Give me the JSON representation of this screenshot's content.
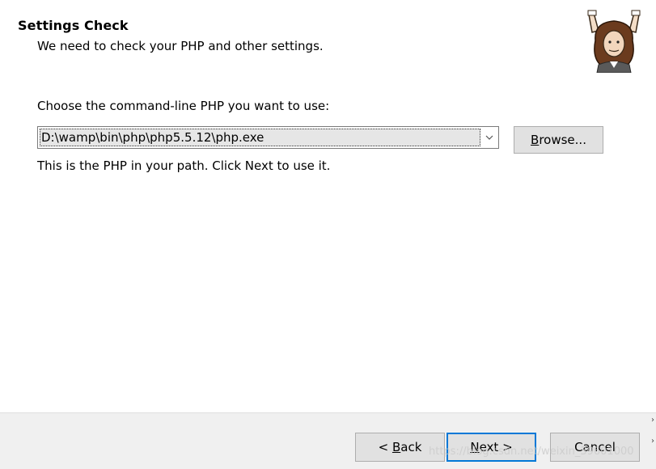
{
  "header": {
    "title": "Settings Check",
    "subtitle": "We need to check your PHP and other settings.",
    "logo_icon": "composer-conductor-logo"
  },
  "main": {
    "prompt_label": "Choose the command-line PHP you want to use:",
    "php_path": {
      "value": "D:\\wamp\\bin\\php\\php5.5.12\\php.exe",
      "dropdown_icon": "chevron-down-icon"
    },
    "browse_button": {
      "label_prefix": "",
      "label_mnemonic": "B",
      "label_rest": "rowse..."
    },
    "hint": "This is the PHP in your path. Click Next to use it."
  },
  "footer": {
    "back_button": {
      "pre": "< ",
      "mnemonic": "B",
      "rest": "ack"
    },
    "next_button": {
      "pre": "",
      "mnemonic": "N",
      "rest": "ext >"
    },
    "cancel_button": {
      "label": "Cancel"
    }
  },
  "watermark": "https://blog.csdn.net/weixin_39601000",
  "colors": {
    "focus_border": "#0078d7",
    "button_face": "#e1e1e1",
    "footer_bg": "#f0f0f0"
  }
}
